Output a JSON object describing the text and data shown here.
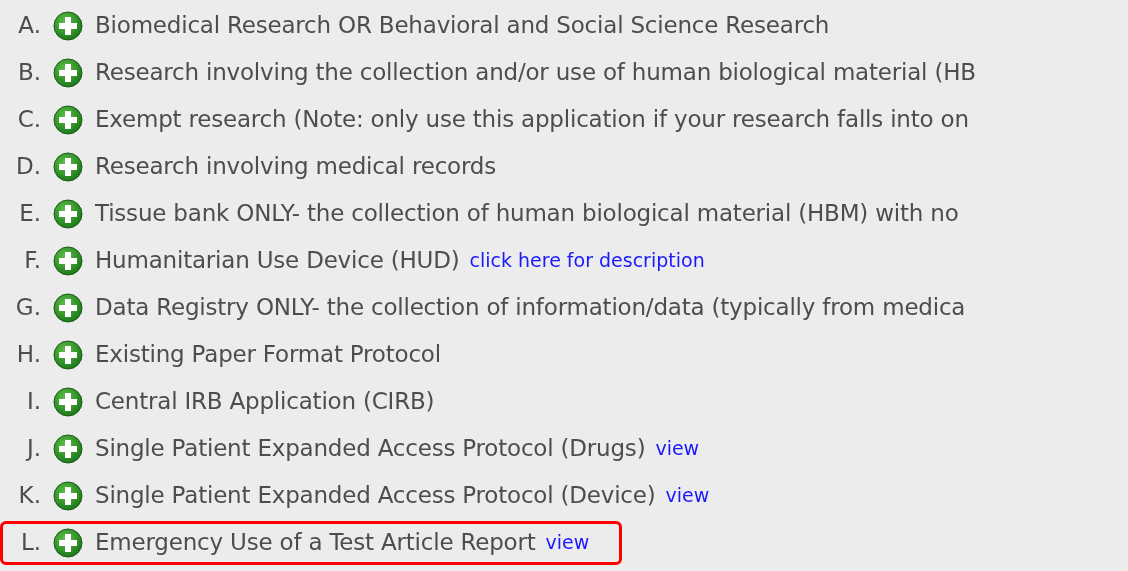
{
  "items": [
    {
      "letter": "A.",
      "text": "Biomedical Research OR Behavioral and Social Science Research",
      "highlighted": false
    },
    {
      "letter": "B.",
      "text": "Research involving the collection and/or use of human biological material (HB",
      "highlighted": false
    },
    {
      "letter": "C.",
      "text": "Exempt research (Note: only use this application if your research falls into on",
      "highlighted": false
    },
    {
      "letter": "D.",
      "text": "Research involving medical records",
      "highlighted": false
    },
    {
      "letter": "E.",
      "text": "Tissue bank ONLY- the collection of human biological material (HBM) with no",
      "highlighted": false
    },
    {
      "letter": "F.",
      "text": "Humanitarian Use Device (HUD)",
      "link": "click here for description",
      "highlighted": false
    },
    {
      "letter": "G.",
      "text": "Data Registry ONLY- the collection of information/data (typically from medica",
      "highlighted": false
    },
    {
      "letter": "H.",
      "text": "Existing Paper Format Protocol",
      "highlighted": false
    },
    {
      "letter": "I.",
      "text": "Central IRB Application (CIRB)",
      "highlighted": false
    },
    {
      "letter": "J.",
      "text": "Single Patient Expanded Access Protocol (Drugs)",
      "link": "view",
      "highlighted": false
    },
    {
      "letter": "K.",
      "text": "Single Patient Expanded Access Protocol (Device)",
      "link": "view",
      "highlighted": false
    },
    {
      "letter": "L.",
      "text": "Emergency Use of a Test Article Report",
      "link": "view",
      "highlighted": true
    }
  ]
}
